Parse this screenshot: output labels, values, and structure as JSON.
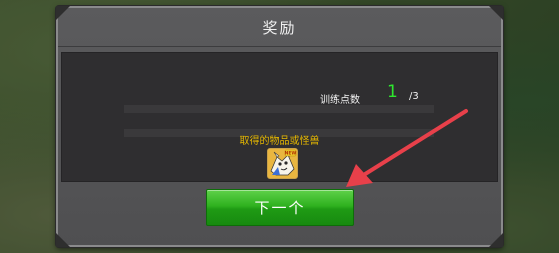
{
  "dialog": {
    "title": "奖励",
    "points_label": "训练点数",
    "points_value": "1",
    "points_max": "/3",
    "reward_caption": "取得的物品或怪兽",
    "reward_item_badge": "NEW",
    "next_label": "下一个"
  },
  "colors": {
    "accent_green": "#2ee82e",
    "caption_yellow": "#e6b800",
    "arrow_red": "#e8404a"
  }
}
